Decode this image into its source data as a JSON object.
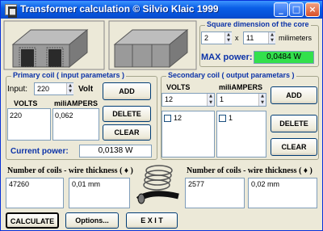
{
  "window": {
    "title": "Transformer calculation © Silvio Klaic 1999",
    "minimize_glyph": "_",
    "maximize_glyph": "□",
    "close_glyph": "×"
  },
  "core": {
    "title": "Square dimension of the core",
    "width": "2",
    "times": "x",
    "depth": "11",
    "unit": "milimeters",
    "max_power_label": "MAX power:",
    "max_power_value": "0,0484 W",
    "max_power_color": "#33e04c"
  },
  "primary": {
    "title": "Primary coil ( input parametars )",
    "input_label": "Input:",
    "input_value": "220",
    "input_unit": "Volt",
    "col_volts": "VOLTS",
    "col_milliamps": "miliAMPERS",
    "volts_value": "220",
    "milliamps_value": "0,062",
    "add_label": "ADD",
    "delete_label": "DELETE",
    "clear_label": "CLEAR",
    "current_power_label": "Current power:",
    "current_power_value": "0,0138 W"
  },
  "secondary": {
    "title": "Secondary coil ( output parametars )",
    "col_volts": "VOLTS",
    "col_milliamps": "miliAMPERS",
    "volts_input": "12",
    "milliamps_input": "1",
    "volts_item": "12",
    "milliamps_item": "1",
    "add_label": "ADD",
    "delete_label": "DELETE",
    "clear_label": "CLEAR"
  },
  "coils_primary": {
    "label": "Number of coils - wire thickness ( ♦ )",
    "count": "47260",
    "thickness": "0,01 mm"
  },
  "coils_secondary": {
    "label": "Number of coils - wire thickness ( ♦ )",
    "count": "2577",
    "thickness": "0,02 mm"
  },
  "buttons": {
    "calculate": "CALCULATE",
    "options": "Options...",
    "exit": "E X I T"
  },
  "icons": [
    "core-e-icon",
    "core-e-icon",
    "coil-spring-icon",
    "app-icon",
    "checkbox",
    "spin-arrows"
  ]
}
